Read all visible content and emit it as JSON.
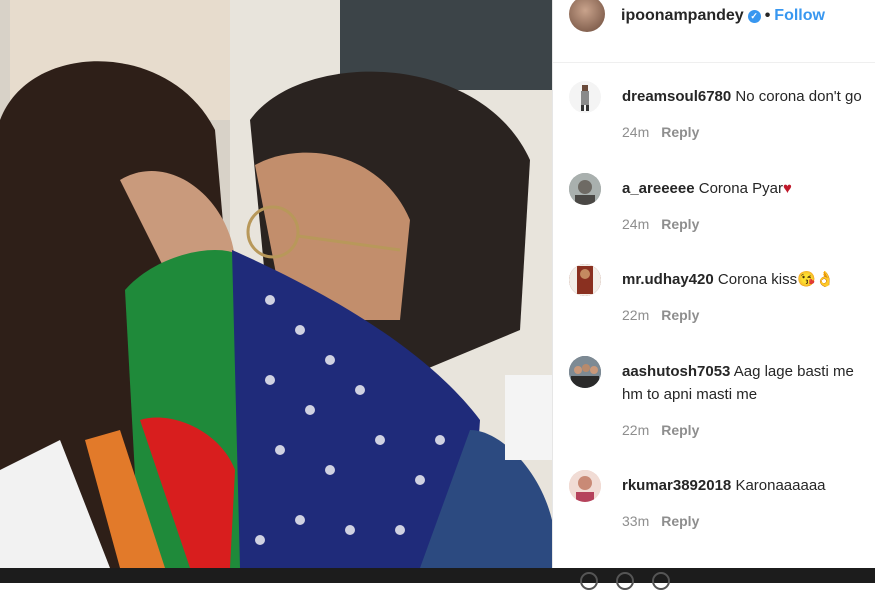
{
  "post": {
    "username": "ipoonampandey",
    "follow_label": "Follow",
    "separator": "•"
  },
  "comments": [
    {
      "user": "dreamsoul6780",
      "text": "No corona don't go",
      "time": "24m",
      "reply": "Reply"
    },
    {
      "user": "a_areeeee",
      "text": "Corona Pyar",
      "emoji": "♥",
      "time": "24m",
      "reply": "Reply"
    },
    {
      "user": "mr.udhay420",
      "text": "Corona kiss",
      "emoji": "😘👌",
      "time": "22m",
      "reply": "Reply"
    },
    {
      "user": "aashutosh7053",
      "text": "Aag lage basti me hm to apni masti me",
      "time": "22m",
      "reply": "Reply"
    },
    {
      "user": "rkumar3892018",
      "text": "Karonaaaaaa",
      "time": "33m",
      "reply": "Reply"
    }
  ],
  "colors": {
    "link": "#3897f0",
    "text": "#262626",
    "muted": "#8e8e8e"
  }
}
